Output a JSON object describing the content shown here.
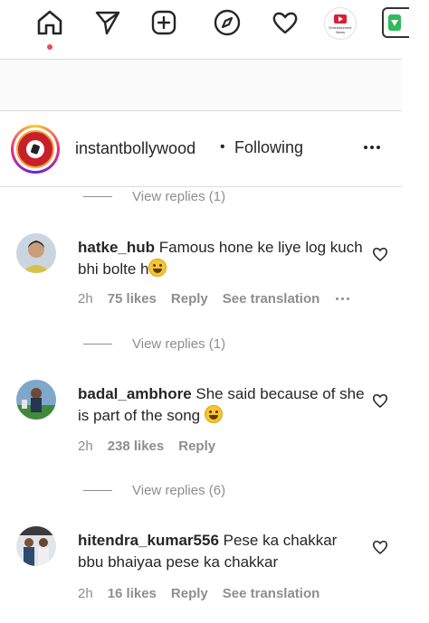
{
  "nav": {
    "profile_caption": "Entertainment News"
  },
  "post": {
    "username": "instantbollywood",
    "bullet": "•",
    "follow_status": "Following"
  },
  "view_replies": [
    "View replies (1)",
    "View replies (1)",
    "View replies (6)"
  ],
  "comments": [
    {
      "username": "hatke_hub",
      "text": "Famous hone ke liye log kuch bhi bolte h",
      "time": "2h",
      "likes": "75 likes",
      "reply": "Reply",
      "translation": "See translation"
    },
    {
      "username": "badal_ambhore",
      "text": "She said because of she is part of the song",
      "time": "2h",
      "likes": "238 likes",
      "reply": "Reply"
    },
    {
      "username": "hitendra_kumar556",
      "text": "Pese ka chakkar bbu bhaiyaa pese ka chakkar",
      "time": "2h",
      "likes": "16 likes",
      "reply": "Reply",
      "translation": "See translation"
    }
  ],
  "colors": {
    "notification_dot": "#ed4956",
    "secondary_text": "#8e8e8e",
    "primary_text": "#262626"
  }
}
